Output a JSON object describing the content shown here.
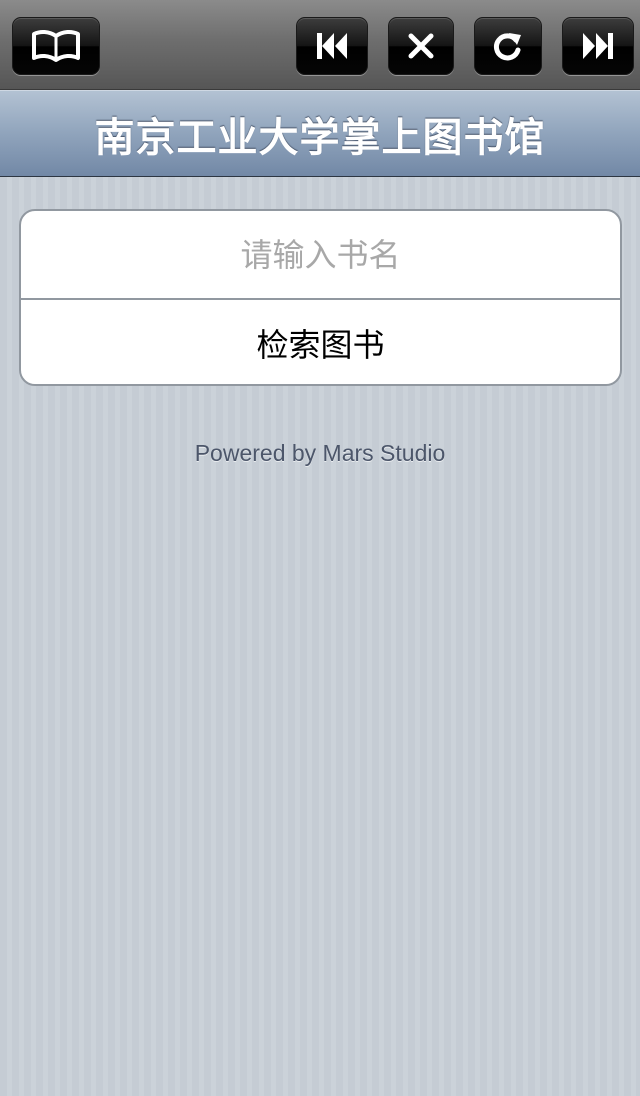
{
  "toolbar": {
    "buttons": [
      {
        "id": "bookmarks",
        "icon": "book-icon"
      },
      {
        "id": "back",
        "icon": "skip-back-icon"
      },
      {
        "id": "stop",
        "icon": "close-icon"
      },
      {
        "id": "reload",
        "icon": "reload-icon"
      },
      {
        "id": "forward",
        "icon": "skip-forward-icon"
      }
    ]
  },
  "header": {
    "title": "南京工业大学掌上图书馆"
  },
  "search": {
    "placeholder": "请输入书名",
    "value": "",
    "button_label": "检索图书"
  },
  "footer": {
    "text": "Powered by Mars Studio"
  },
  "colors": {
    "background": "#c5ccd4",
    "titlebar": "#90a4bc",
    "toolbar": "#6e6e6e"
  }
}
